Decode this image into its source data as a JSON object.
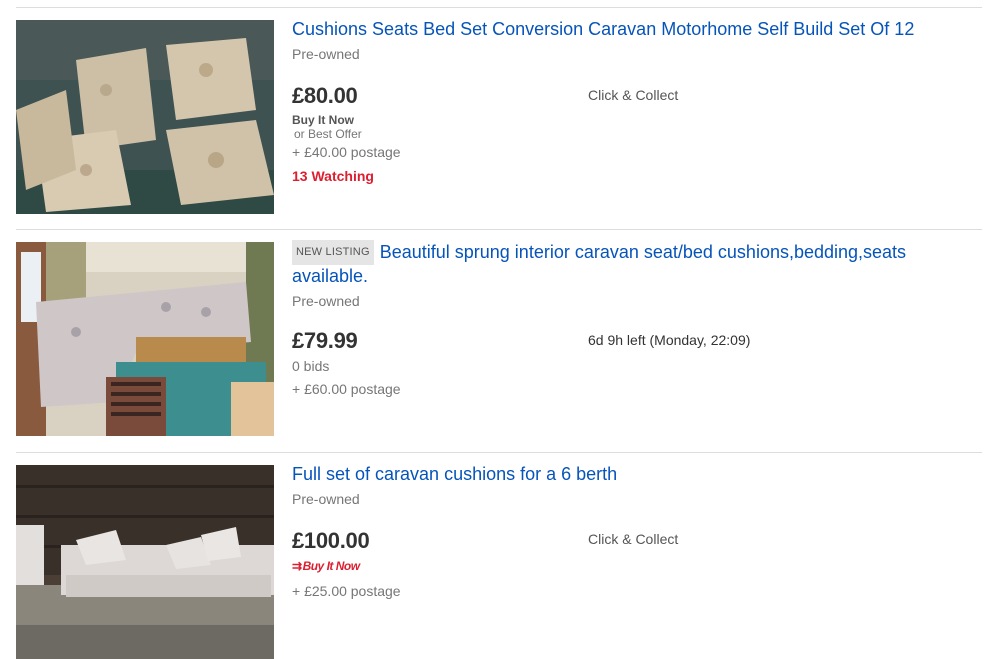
{
  "listings": [
    {
      "title": "Cushions Seats Bed Set Conversion Caravan Motorhome Self Build Set Of 12",
      "condition": "Pre-owned",
      "price": "£80.00",
      "format": "Buy It Now",
      "offer": "or Best Offer",
      "postage": "+ £40.00 postage",
      "watching": "13 Watching",
      "right_info": "Click & Collect"
    },
    {
      "badge": "NEW LISTING",
      "title": "Beautiful sprung interior caravan seat/bed cushions,bedding,seats available.",
      "condition": "Pre-owned",
      "price": "£79.99",
      "bids": "0 bids",
      "postage": "+ £60.00 postage",
      "right_info": "6d 9h left (Monday, 22:09)"
    },
    {
      "title": "Full set of caravan cushions for a 6 berth",
      "condition": "Pre-owned",
      "price": "£100.00",
      "format_logo": "Buy It Now",
      "postage": "+ £25.00 postage",
      "right_info": "Click & Collect"
    }
  ]
}
